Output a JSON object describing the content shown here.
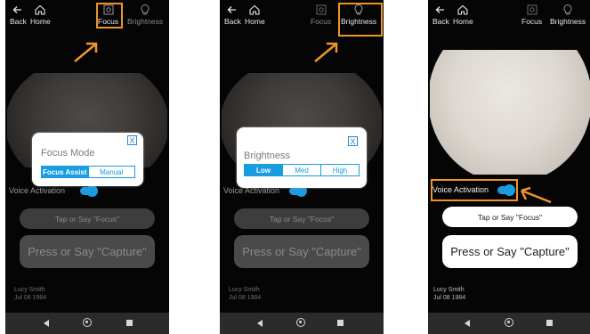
{
  "colors": {
    "accent": "#1a9ce0",
    "highlight": "#f0942a"
  },
  "screens": [
    {
      "toolbar": {
        "back": "Back",
        "home": "Home",
        "focus": "Focus",
        "brightness": "Brightness"
      },
      "dialog": {
        "title": "Focus Mode",
        "close": "X",
        "options": [
          "Focus Assist",
          "Manual"
        ],
        "selected": "Focus Assist"
      },
      "voice_activation": "Voice Activation",
      "focus_button": "Tap or Say \"Focus\"",
      "capture_button": "Press or Say \"Capture\"",
      "patient": {
        "name": "Lucy Smith",
        "dob": "Jul 08 1984"
      }
    },
    {
      "toolbar": {
        "back": "Back",
        "home": "Home",
        "focus": "Focus",
        "brightness": "Brightness"
      },
      "dialog": {
        "title": "Brightness",
        "close": "X",
        "options": [
          "Low",
          "Med",
          "High"
        ],
        "selected": "Low"
      },
      "voice_activation": "Voice Activation",
      "focus_button": "Tap or Say \"Focus\"",
      "capture_button": "Press or Say \"Capture\"",
      "patient": {
        "name": "Lucy Smith",
        "dob": "Jul 08 1984"
      }
    },
    {
      "toolbar": {
        "back": "Back",
        "home": "Home",
        "focus": "Focus",
        "brightness": "Brightness"
      },
      "voice_activation": "Voice Activation",
      "focus_button": "Tap or Say \"Focus\"",
      "capture_button": "Press or Say \"Capture\"",
      "patient": {
        "name": "Lucy Smith",
        "dob": "Jul 08 1984"
      }
    }
  ]
}
